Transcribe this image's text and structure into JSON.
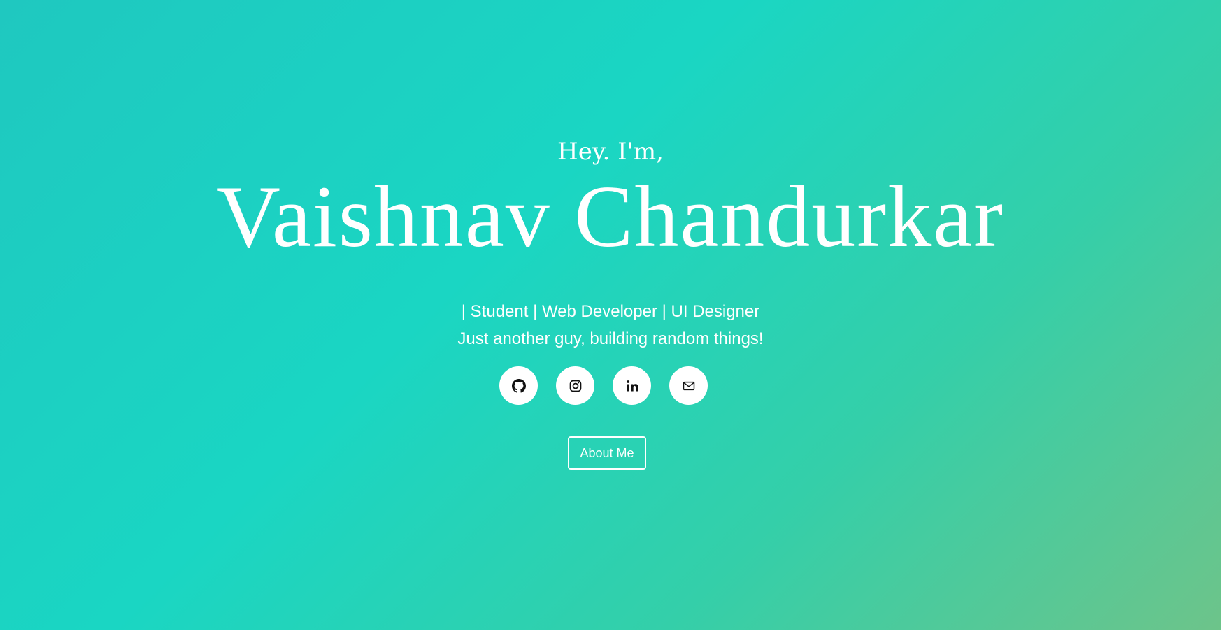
{
  "hero": {
    "greeting": "Hey. I'm,",
    "name": "Vaishnav Chandurkar",
    "roles": "| Student | Web Developer | UI Designer",
    "tagline": "Just another guy, building random things!"
  },
  "socials": [
    {
      "icon": "github-icon"
    },
    {
      "icon": "instagram-icon"
    },
    {
      "icon": "linkedin-icon"
    },
    {
      "icon": "mail-icon"
    }
  ],
  "about_button": {
    "label": "About Me"
  },
  "colors": {
    "gradient_start": "#1fc8c0",
    "gradient_mid": "#1ad6c3",
    "gradient_end": "#6dc48a",
    "text": "#ffffff",
    "icon": "#111111"
  }
}
